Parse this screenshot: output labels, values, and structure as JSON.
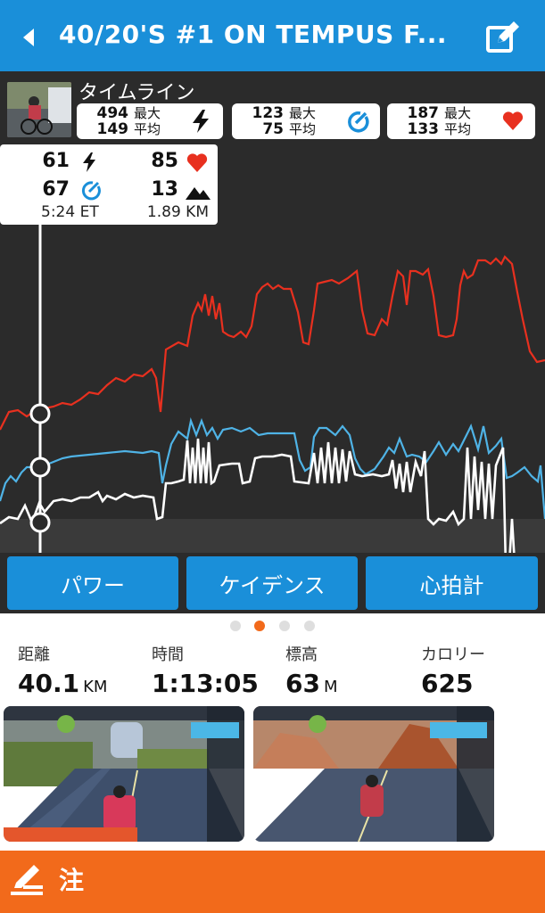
{
  "header": {
    "title": "40/20'S #1 ON TEMPUS F...",
    "back_icon": "back-chevron-icon",
    "edit_icon": "edit-icon"
  },
  "timeline": {
    "label": "タイムライン",
    "power": {
      "max": "494",
      "avg": "149",
      "max_label": "最大",
      "avg_label": "平均"
    },
    "cadence": {
      "max": "123",
      "avg": "75",
      "max_label": "最大",
      "avg_label": "平均"
    },
    "heart": {
      "max": "187",
      "avg": "133",
      "max_label": "最大",
      "avg_label": "平均"
    },
    "readout": {
      "power": "61",
      "heart": "85",
      "cadence": "67",
      "elevation": "13",
      "time": "5:24 ET",
      "distance": "1.89 KM"
    }
  },
  "tabs": [
    "パワー",
    "ケイデンス",
    "心拍計"
  ],
  "pagination": {
    "count": 4,
    "active": 1
  },
  "summary": [
    {
      "label": "距離",
      "value": "40.1",
      "unit": "KM"
    },
    {
      "label": "時間",
      "value": "1:13:05",
      "unit": ""
    },
    {
      "label": "標高",
      "value": "63",
      "unit": "M"
    },
    {
      "label": "カロリー",
      "value": "625",
      "unit": ""
    }
  ],
  "footer": {
    "label": "注",
    "icon": "write-icon"
  },
  "colors": {
    "blue": "#1a8fd9",
    "orange": "#f26a1b",
    "heart": "#e8301f",
    "cadence": "#4fb3e6",
    "power": "#ffffff"
  }
}
